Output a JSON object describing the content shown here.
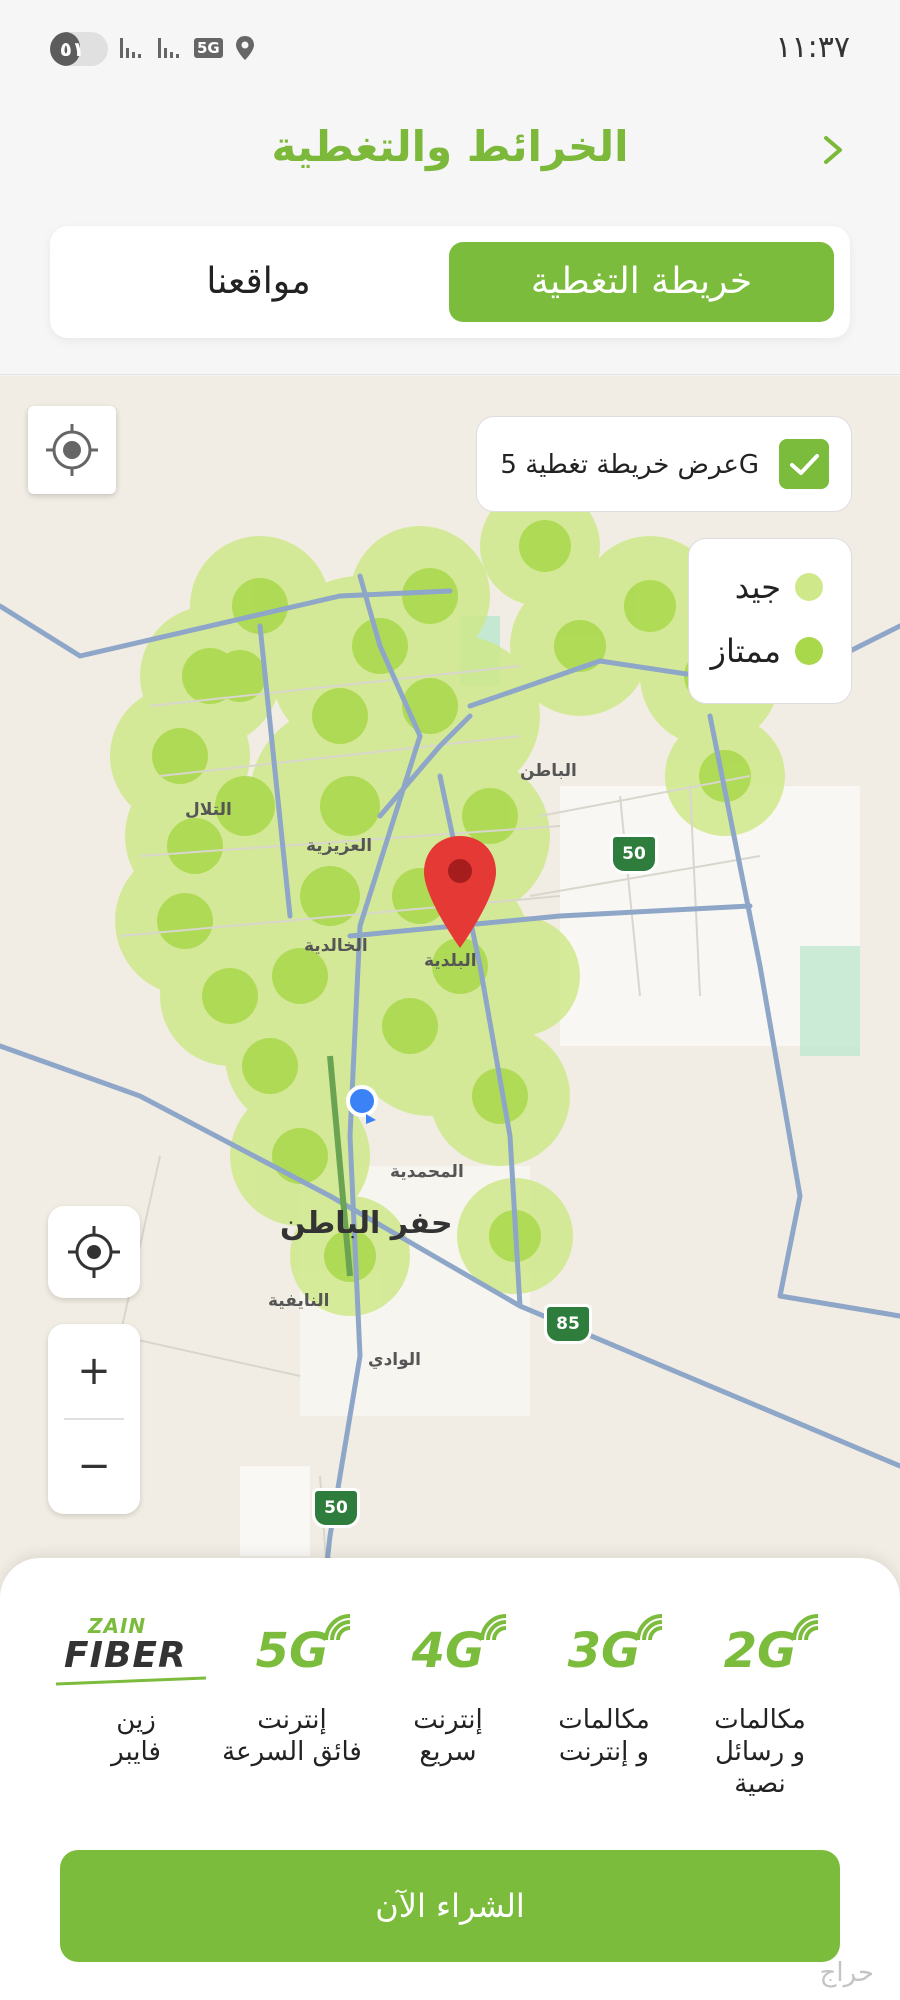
{
  "status_bar": {
    "battery": "٥١",
    "battery_level": 0.51,
    "network": "5G",
    "time": "١١:٣٧"
  },
  "header": {
    "title": "الخرائط والتغطية"
  },
  "tabs": [
    {
      "label": "خريطة التغطية",
      "active": true
    },
    {
      "label": "مواقعنا",
      "active": false
    }
  ],
  "map": {
    "toggle_5g_label": "عرض خريطة تغطية 5G",
    "toggle_5g_checked": true,
    "legend": [
      {
        "label": "جيد",
        "color": "#cfe98a"
      },
      {
        "label": "ممتاز",
        "color": "#a9d84a"
      }
    ],
    "districts": [
      "التلال",
      "العزيزية",
      "الباطن",
      "الخالدية",
      "البلدية",
      "المحمدية",
      "النايفية",
      "الوادي"
    ],
    "city": "حفر الباطن",
    "road_numbers": [
      "50",
      "85",
      "50"
    ],
    "zoom_in": "+",
    "zoom_out": "−"
  },
  "networks": [
    {
      "code": "2G",
      "description": "مكالمات\nو رسائل\nنصية"
    },
    {
      "code": "3G",
      "description": "مكالمات\nو إنترنت"
    },
    {
      "code": "4G",
      "description": "إنترنت\nسريع"
    },
    {
      "code": "5G",
      "description": "إنترنت\nفائق السرعة"
    },
    {
      "code": "FIBER",
      "brand": "ZAIN",
      "description": "زين\nفايبر"
    }
  ],
  "buy_button": "الشراء الآن",
  "watermark": "حراج",
  "colors": {
    "accent": "#7cbc3c",
    "title": "#7cb83a",
    "coverage_good": "#cfe98a",
    "coverage_excellent": "#a9d84a",
    "pin": "#e53935",
    "user_dot": "#3b82f6"
  }
}
